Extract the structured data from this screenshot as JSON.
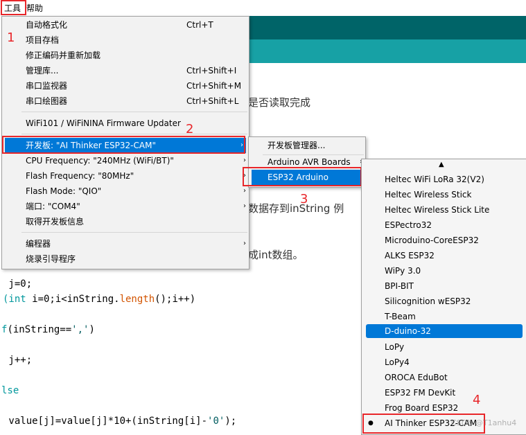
{
  "menubar": {
    "tools": "工具",
    "help": "帮助"
  },
  "editor": {
    "comment1": "是否读取完成",
    "comment2": "数据存到inString 例",
    "comment3": "成int数组。",
    "code": {
      "l1": " j=0;",
      "l2_kw1": "(int",
      "l2_a": " i=0;i<inString.",
      "l2_fn": "length",
      "l2_b": "();i++)",
      "l3_kw": "f",
      "l3_a": "(inString==",
      "l3_str": "','",
      "l3_b": ")",
      "l4": " j++;",
      "l5_kw": "lse",
      "l6_a": " value[j]=value[j]*10+(inString[i]-",
      "l6_str": "'0'",
      "l6_b": ");"
    }
  },
  "tools_menu": {
    "items": [
      {
        "label": "自动格式化",
        "shortcut": "Ctrl+T"
      },
      {
        "label": "项目存档",
        "shortcut": ""
      },
      {
        "label": "修正编码并重新加载",
        "shortcut": ""
      },
      {
        "label": "管理库...",
        "shortcut": "Ctrl+Shift+I"
      },
      {
        "label": "串口监视器",
        "shortcut": "Ctrl+Shift+M"
      },
      {
        "label": "串口绘图器",
        "shortcut": "Ctrl+Shift+L"
      },
      {
        "label": "WiFi101 / WiFiNINA Firmware Updater",
        "shortcut": ""
      },
      {
        "label": "开发板: \"AI Thinker ESP32-CAM\"",
        "shortcut": ""
      },
      {
        "label": "CPU Frequency: \"240MHz (WiFi/BT)\"",
        "shortcut": ""
      },
      {
        "label": "Flash Frequency: \"80MHz\"",
        "shortcut": ""
      },
      {
        "label": "Flash Mode: \"QIO\"",
        "shortcut": ""
      },
      {
        "label": "端口: \"COM4\"",
        "shortcut": ""
      },
      {
        "label": "取得开发板信息",
        "shortcut": ""
      },
      {
        "label": "编程器",
        "shortcut": ""
      },
      {
        "label": "烧录引导程序",
        "shortcut": ""
      }
    ]
  },
  "board_menu": {
    "items": [
      {
        "label": "开发板管理器..."
      },
      {
        "label": "Arduino AVR Boards"
      },
      {
        "label": "ESP32 Arduino"
      }
    ]
  },
  "esp32_menu": {
    "items": [
      {
        "label": "Heltec WiFi LoRa 32(V2)"
      },
      {
        "label": "Heltec Wireless Stick"
      },
      {
        "label": "Heltec Wireless Stick Lite"
      },
      {
        "label": "ESPectro32"
      },
      {
        "label": "Microduino-CoreESP32"
      },
      {
        "label": "ALKS ESP32"
      },
      {
        "label": "WiPy 3.0"
      },
      {
        "label": "BPI-BIT"
      },
      {
        "label": "Silicognition wESP32"
      },
      {
        "label": "T-Beam"
      },
      {
        "label": "D-duino-32"
      },
      {
        "label": "LoPy"
      },
      {
        "label": "LoPy4"
      },
      {
        "label": "OROCA EduBot"
      },
      {
        "label": "ESP32 FM DevKit"
      },
      {
        "label": "Frog Board ESP32"
      },
      {
        "label": "AI Thinker ESP32-CAM"
      }
    ],
    "selected_bullet": "●",
    "scroll_up": "▲"
  },
  "annotations": {
    "n1": "1",
    "n2": "2",
    "n3": "3",
    "n4": "4"
  },
  "watermark": "CSDN @T1anhu4",
  "colors": {
    "highlight": "#0078d7",
    "red": "#e8262a",
    "teal_dark": "#006468",
    "teal_light": "#17a1a5"
  }
}
